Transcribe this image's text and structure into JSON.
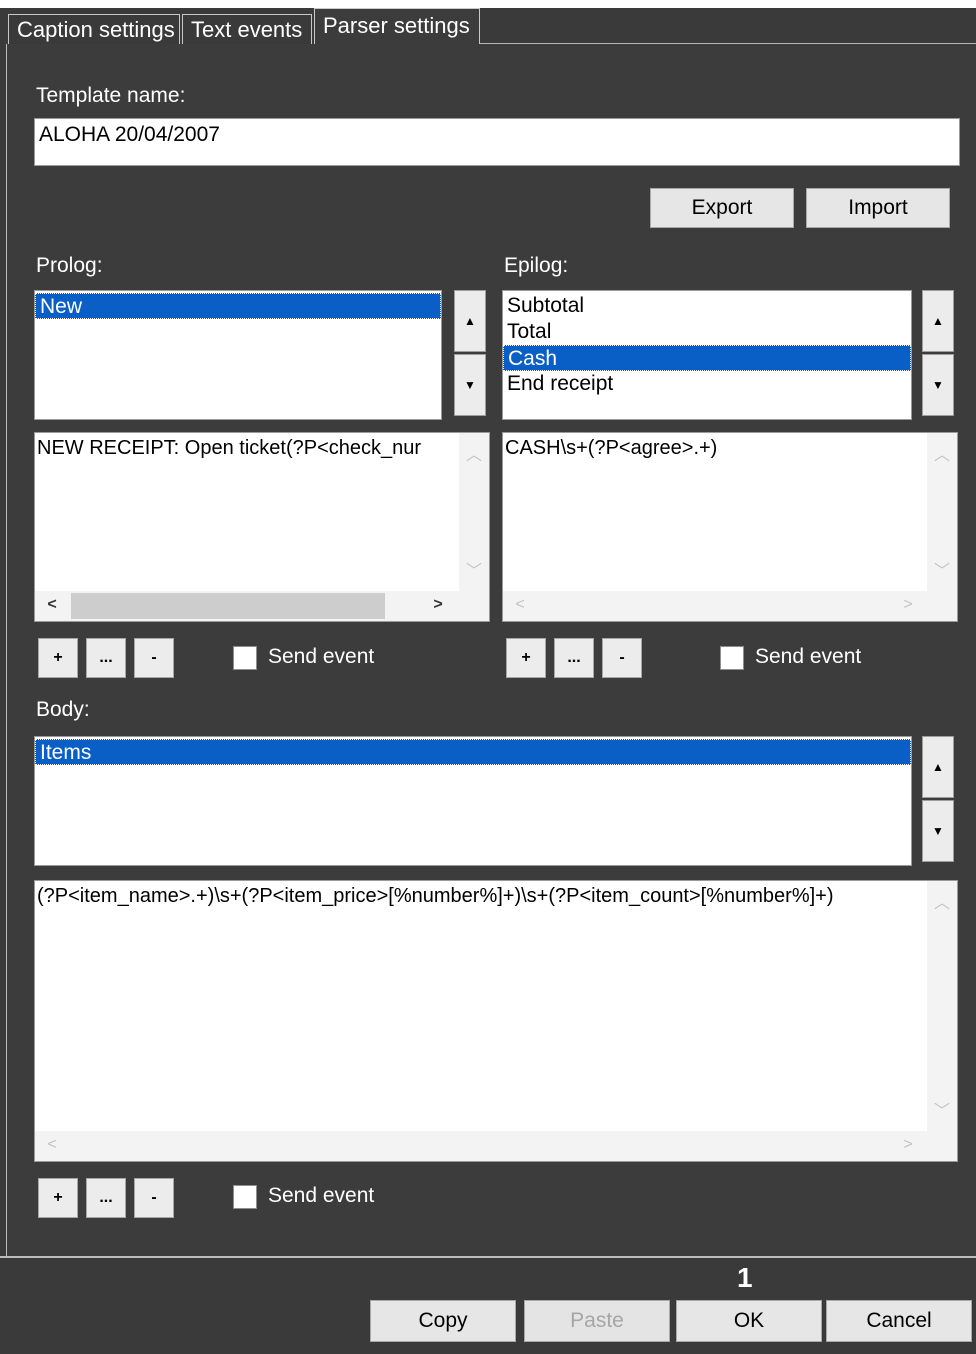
{
  "tabs": [
    {
      "label": "Caption settings",
      "active": false
    },
    {
      "label": "Text events",
      "active": false
    },
    {
      "label": "Parser settings",
      "active": true
    }
  ],
  "template": {
    "label": "Template name:",
    "value": "ALOHA 20/04/2007"
  },
  "buttons": {
    "export": "Export",
    "import": "Import"
  },
  "prolog": {
    "label": "Prolog:",
    "items": [
      "New"
    ],
    "selected": "New",
    "code": "NEW RECEIPT: Open ticket(?P<check_nur",
    "add": "+",
    "edit": "...",
    "remove": "-",
    "send_event": "Send event",
    "send_event_checked": false
  },
  "epilog": {
    "label": "Epilog:",
    "items": [
      "Subtotal",
      "Total",
      "Cash",
      "End receipt"
    ],
    "selected": "Cash",
    "code": "CASH\\s+(?P<agree>.+)",
    "add": "+",
    "edit": "...",
    "remove": "-",
    "send_event": "Send event",
    "send_event_checked": false
  },
  "body": {
    "label": "Body:",
    "items": [
      "Items"
    ],
    "selected": "Items",
    "code": "(?P<item_name>.+)\\s+(?P<item_price>[%number%]+)\\s+(?P<item_count>[%number%]+)",
    "add": "+",
    "edit": "...",
    "remove": "-",
    "send_event": "Send event",
    "send_event_checked": false
  },
  "footer": {
    "marker": "1",
    "copy": "Copy",
    "paste": "Paste",
    "paste_enabled": false,
    "ok": "OK",
    "cancel": "Cancel"
  },
  "colors": {
    "background": "#3c3c3c",
    "selection": "#0a5fc7"
  }
}
